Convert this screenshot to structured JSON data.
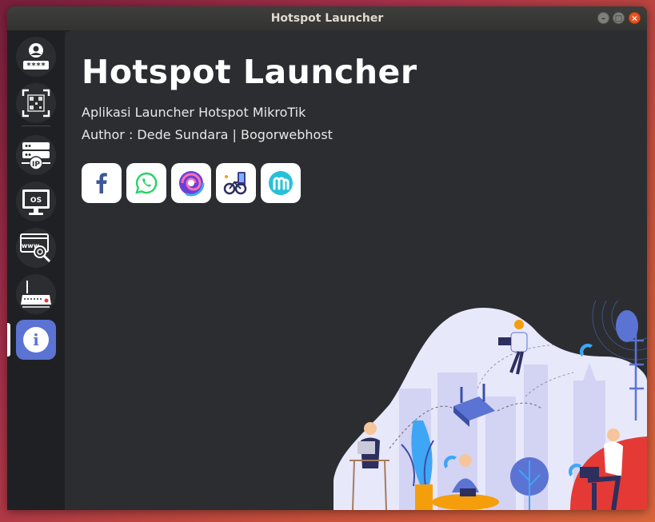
{
  "window": {
    "title": "Hotspot Launcher"
  },
  "sidebar": {
    "items": [
      {
        "name": "user-login",
        "icon": "user-password-icon",
        "glyph": "****"
      },
      {
        "name": "qr-code",
        "icon": "qr-code-icon"
      },
      {
        "name": "ip-server",
        "icon": "ip-server-icon",
        "glyph": "IP"
      },
      {
        "name": "os",
        "icon": "monitor-os-icon",
        "glyph": "OS"
      },
      {
        "name": "www-search",
        "icon": "www-search-icon",
        "glyph": "www"
      },
      {
        "name": "router",
        "icon": "router-icon"
      },
      {
        "name": "info",
        "icon": "info-icon",
        "glyph": "i",
        "active": true
      }
    ]
  },
  "main": {
    "title": "Hotspot Launcher",
    "description": "Aplikasi Launcher Hotspot MikroTik",
    "author": "Author : Dede Sundara | Bogorwebhost",
    "social": [
      {
        "name": "facebook",
        "icon": "facebook-icon",
        "color": "#3b5998"
      },
      {
        "name": "whatsapp",
        "icon": "whatsapp-icon",
        "color": "#25d366"
      },
      {
        "name": "browser",
        "icon": "swirl-browser-icon",
        "color": "#7b4fe0"
      },
      {
        "name": "bike",
        "icon": "bike-app-icon",
        "color": "#3a3f8f"
      },
      {
        "name": "m-app",
        "icon": "m-app-icon",
        "color": "#26c1d9"
      }
    ]
  },
  "colors": {
    "accent": "#5b73d3",
    "close": "#e95420",
    "blob": "#e8e8fb"
  }
}
